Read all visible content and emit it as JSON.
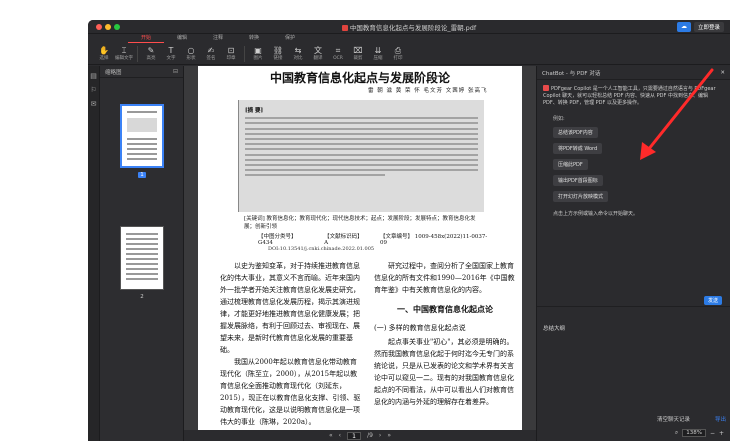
{
  "window": {
    "title": "中国教育信息化起点与发展阶段论_雷朝.pdf",
    "login_label": "立即登录"
  },
  "menubar": [
    "开始",
    "编辑",
    "注释",
    "转换",
    "保护"
  ],
  "toolbar": [
    {
      "icon": "hand-icon",
      "label": "选择"
    },
    {
      "icon": "cursor-icon",
      "label": "编辑文字"
    },
    {
      "icon": "highlight-icon",
      "label": "高亮"
    },
    {
      "icon": "text-icon",
      "label": "文字"
    },
    {
      "icon": "shape-icon",
      "label": "形状"
    },
    {
      "icon": "sign-icon",
      "label": "签名"
    },
    {
      "icon": "stamp-icon",
      "label": "印章"
    },
    {
      "icon": "image-icon",
      "label": "图片"
    },
    {
      "icon": "link-icon",
      "label": "链接"
    },
    {
      "icon": "compare-icon",
      "label": "对比"
    },
    {
      "icon": "translate-icon",
      "label": "翻译"
    },
    {
      "icon": "ocr-icon",
      "label": "OCR"
    },
    {
      "icon": "crop-icon",
      "label": "裁剪"
    },
    {
      "icon": "compress-icon",
      "label": "压缩"
    },
    {
      "icon": "print-icon",
      "label": "打印"
    }
  ],
  "thumbnail_panel": {
    "title": "缩略图",
    "pages": [
      "1",
      "2"
    ]
  },
  "document": {
    "title": "中国教育信息化起点与发展阶段论",
    "authors": "雷 朝 滋 黄 荣 怀 毛文芳 文茜婷 张高飞",
    "abstract_label": "[摘 要]",
    "keywords": "[关键词] 教育信息化；教育现代化；现代信息技术；起点；发展阶段；发展特点；教育信息化发展；创新引领",
    "class_no": "【中图分类号】 G434",
    "doc_code": "【文献标识码】 A",
    "article_no": "【文章编号】 1009-458x(2022)11-0037-09",
    "doi": "DOI:10.13541/j.cnki.chinade.2022.01.005",
    "left_col": "以史为鉴知变革，对于持续推进教育信息化的伟大事业，其意义不言而喻。近年来国内外一批学者开始关注教育信息化发展史研究，通过梳理教育信息化发展历程，揭示其演进规律，才能更好地推进教育信息化健康发展；把握发展脉络，有利于回顾过去、审视现在、展望未来，是新时代教育信息化发展的重要基础。",
    "left_col2": "我国从2000年起以教育信息化带动教育现代化（陈至立，2000），从2015年起以教育信息化全面推动教育现代化（刘延东，2015），现正在以教育信息化支撑、引领、驱动教育现代化，这是以说明教育信息化是一项伟大的事业（陈琳，2020a）。",
    "right_col_intro": "研究过程中，查阅分析了全国国家上教育信息化的所有文件和1990—2016年《中国教育年鉴》中有关教育信息化的内容。",
    "section_heading": "一、中国教育信息化起点论",
    "sub_heading": "(一) 多样的教育信息化起点说",
    "right_col": "起点事关事业\"初心\"，其必须是明确的。然而我国教育信息化起于何时迄今无专门的系统论说，只是从已发表的论文和学术界有关言论中可以窥见一二。现有的对我国教育信息化起点的不同看法，从中可以看出人们对教育信息化的内涵与外延的理解存在着差异。"
  },
  "pagebar": {
    "current": "1",
    "total": "/9"
  },
  "chat": {
    "header": "ChatBot - 与 PDF 对话",
    "intro": "PDFgear Copilot 是一个人工智能工具，只需要通过自然语言与 PDFgear Copilot 聊天，就可以轻松总结 PDF 内容、快速从 PDF 中找到信息、编辑 PDF、转换 PDF，管理 PDF 以及更多操作。",
    "example_label": "例如:",
    "chips": [
      "总结该PDF内容",
      "将PDF转成 Word",
      "压缩此PDF",
      "输出PDF首段图标",
      "打开幻灯片放映模式"
    ],
    "footer": "点击上方示例或输入命令以开始聊天。",
    "send_label": "发送",
    "input_text": "总结大纲",
    "clear_label": "清空聊天记录",
    "link_label": "导出",
    "zoom": "138%"
  },
  "colors": {
    "accent": "#ff4d4d",
    "brand_blue": "#2c7be5",
    "arrow": "#ff2a2a"
  }
}
